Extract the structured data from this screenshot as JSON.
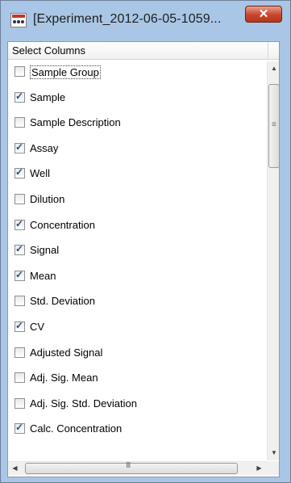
{
  "window": {
    "title": "[Experiment_2012-06-05-1059...",
    "close_glyph": "✕",
    "icon": "app-icon"
  },
  "table": {
    "header": "Select Columns",
    "items": [
      {
        "label": "Sample Group",
        "checked": false,
        "focused": true
      },
      {
        "label": "Sample",
        "checked": true
      },
      {
        "label": "Sample Description",
        "checked": false
      },
      {
        "label": "Assay",
        "checked": true
      },
      {
        "label": "Well",
        "checked": true
      },
      {
        "label": "Dilution",
        "checked": false
      },
      {
        "label": "Concentration",
        "checked": true
      },
      {
        "label": "Signal",
        "checked": true
      },
      {
        "label": "Mean",
        "checked": true
      },
      {
        "label": "Std. Deviation",
        "checked": false
      },
      {
        "label": "CV",
        "checked": true
      },
      {
        "label": "Adjusted Signal",
        "checked": false
      },
      {
        "label": "Adj. Sig. Mean",
        "checked": false
      },
      {
        "label": "Adj. Sig. Std. Deviation",
        "checked": false
      },
      {
        "label": "Calc. Concentration",
        "checked": true
      }
    ]
  },
  "scroll": {
    "up": "▲",
    "down": "▼",
    "left": "◀",
    "right": "▶",
    "vgrip": "≡",
    "hgrip": "III"
  },
  "colors": {
    "check": "#2b4a87",
    "close": "#c8452b",
    "frame": "#a9c6e6"
  }
}
